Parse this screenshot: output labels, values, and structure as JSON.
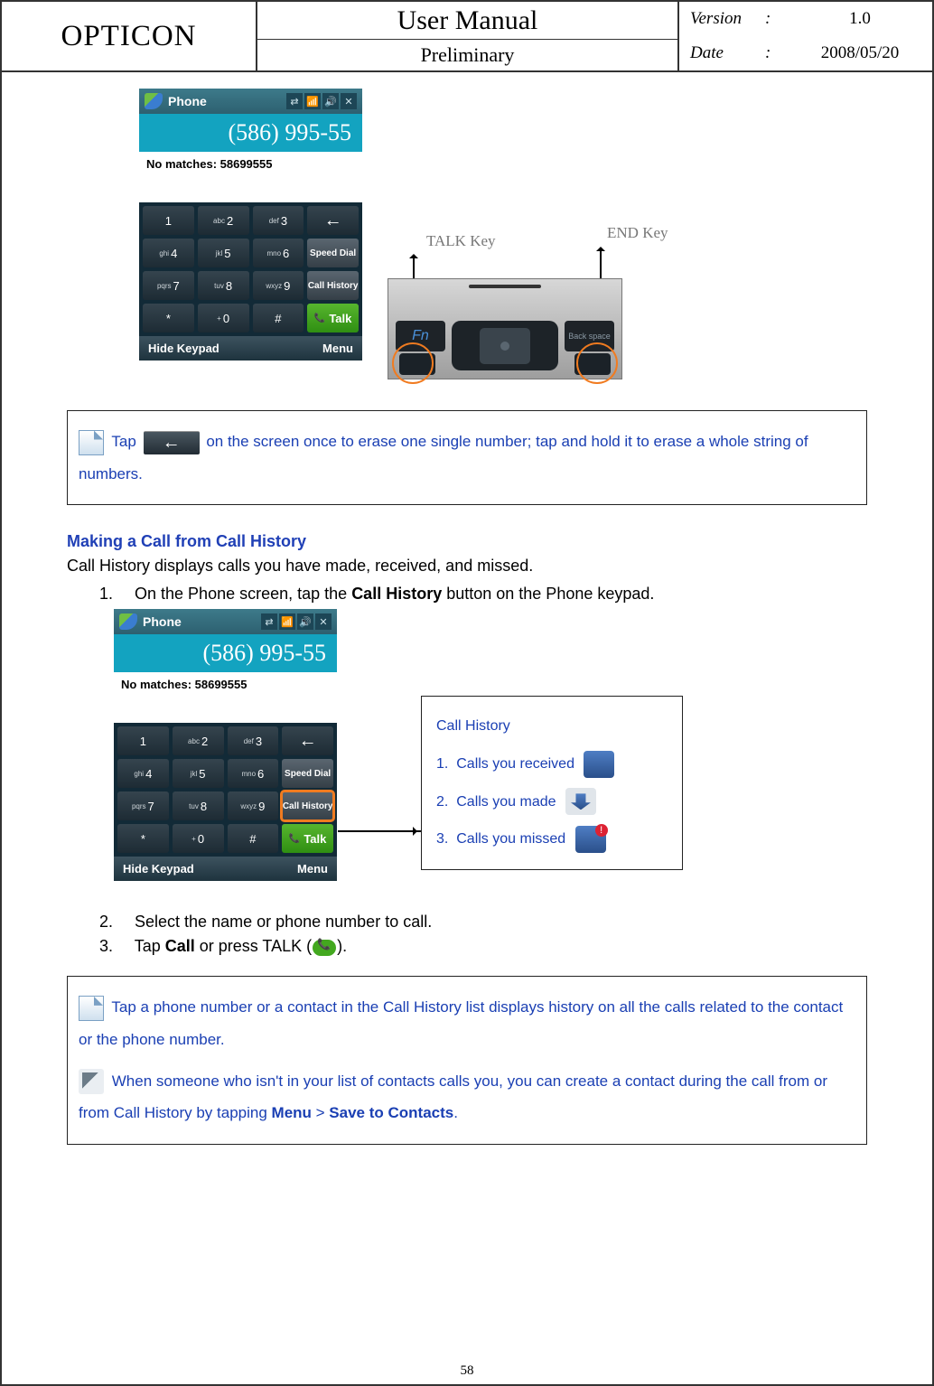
{
  "header": {
    "brand": "OPTICON",
    "title": "User Manual",
    "subtitle": "Preliminary",
    "version_label": "Version",
    "date_label": "Date",
    "colon": ":",
    "version_value": "1.0",
    "date_value": "2008/05/20"
  },
  "phone": {
    "appTitle": "Phone",
    "dialed": "(586) 995-55",
    "noMatches": "No matches: 58699555",
    "keys": {
      "1": "1",
      "2": "2",
      "2sub": "abc",
      "3": "3",
      "3sub": "def",
      "4": "4",
      "4sub": "ghi",
      "5": "5",
      "5sub": "jkl",
      "6": "6",
      "6sub": "mno",
      "7": "7",
      "7sub": "pqrs",
      "8": "8",
      "8sub": "tuv",
      "9": "9",
      "9sub": "wxyz",
      "0": "0",
      "0sub": "+",
      "star": "*",
      "hash": "#",
      "back": "←",
      "speedDial": "Speed Dial",
      "callHistory": "Call History",
      "talk": "Talk"
    },
    "hideKeypad": "Hide Keypad",
    "menu": "Menu",
    "statusIconX": "✕"
  },
  "hw": {
    "talkLabel": "TALK Key",
    "endLabel": "END Key",
    "fn": "Fn",
    "backspace": "Back space"
  },
  "tips": {
    "tap_prefix": "Tap",
    "tap_suffix": "on the screen once to erase one single number; tap and hold it to erase a whole string of numbers.",
    "backGlyph": "←"
  },
  "section": {
    "title": "Making a Call from Call History",
    "intro": "Call History displays calls you have made, received, and missed.",
    "step1_n": "1.",
    "step1_a": "On the Phone screen, tap the ",
    "step1_bold": "Call History",
    "step1_b": " button on the Phone keypad.",
    "step2_n": "2.",
    "step2": "Select the name or phone number to call.",
    "step3_n": "3.",
    "step3_a": "Tap ",
    "step3_bold": "Call",
    "step3_b": " or press TALK (",
    "step3_c": ")."
  },
  "legend": {
    "title": "Call History",
    "n1": "1.",
    "i1": "Calls you received",
    "n2": "2.",
    "i2": "Calls you made",
    "n3": "3.",
    "i3": "Calls you missed"
  },
  "bottomTips": {
    "t1": "Tap a phone number or a contact in the Call History list displays history on all the calls related to the contact or the phone number.",
    "t2_a": "When someone who isn't in your list of contacts calls you, you can create a contact during the call from or from Call History by tapping ",
    "t2_bold1": "Menu",
    "t2_mid": " > ",
    "t2_bold2": "Save to Contacts",
    "t2_end": "."
  },
  "pageNumber": "58"
}
